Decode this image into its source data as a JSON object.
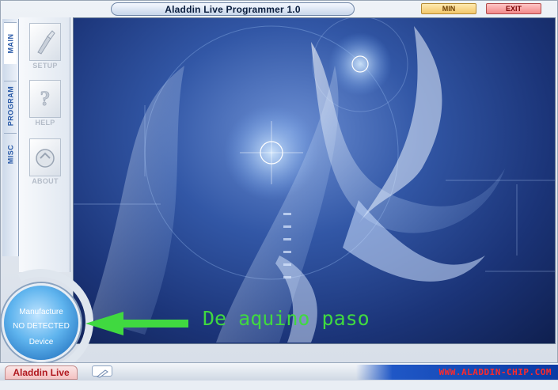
{
  "window": {
    "title": "Aladdin Live Programmer 1.0",
    "min_label": "MIN",
    "exit_label": "EXIT"
  },
  "tabs": [
    {
      "label": "MAIN"
    },
    {
      "label": "PROGRAM"
    },
    {
      "label": "MISC"
    }
  ],
  "tools": [
    {
      "label": "SETUP",
      "icon": "setup-icon"
    },
    {
      "label": "HELP",
      "icon": "help-icon"
    },
    {
      "label": "ABOUT",
      "icon": "about-icon"
    }
  ],
  "status": {
    "line1": "Manufacture",
    "line2": "NO DETECTED",
    "line3": "Device"
  },
  "annotation": {
    "text": "De aquino paso",
    "color": "#40d940"
  },
  "footer": {
    "brand": "Aladdin Live",
    "url": "WWW.ALADDIN-CHIP.COM"
  },
  "colors": {
    "accent": "#2b5ba8",
    "brand": "#b1191f",
    "url": "#ff2a2a"
  }
}
